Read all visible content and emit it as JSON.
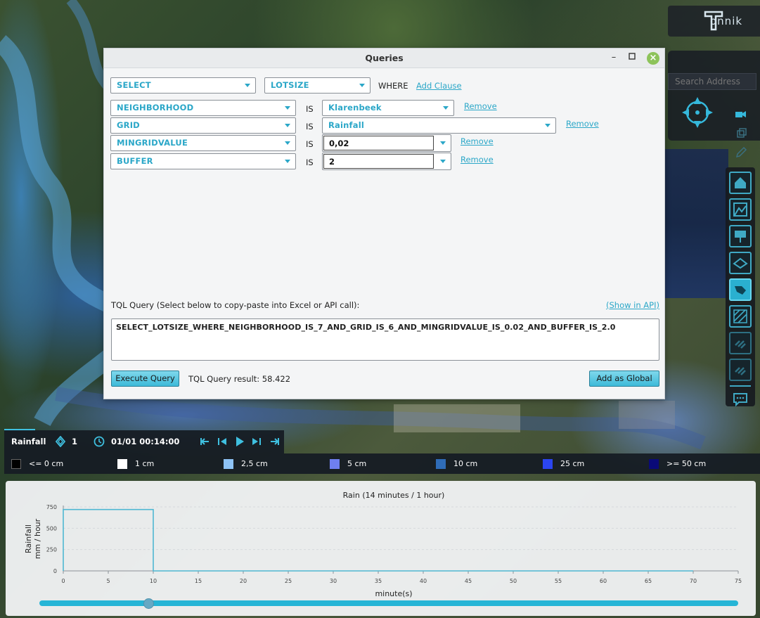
{
  "app": {
    "logo_text": "onnik"
  },
  "search": {
    "placeholder": "Search Address"
  },
  "dialog": {
    "title": "Queries",
    "header_row": {
      "select_value": "SELECT",
      "attribute_value": "LOTSIZE",
      "where_label": "WHERE",
      "add_clause_label": "Add Clause"
    },
    "clauses": [
      {
        "field": "NEIGHBORHOOD",
        "operator": "IS",
        "value": "Klarenbeek",
        "remove_label": "Remove"
      },
      {
        "field": "GRID",
        "operator": "IS",
        "value": "Rainfall",
        "remove_label": "Remove"
      },
      {
        "field": "MINGRIDVALUE",
        "operator": "IS",
        "value": "0,02",
        "remove_label": "Remove"
      },
      {
        "field": "BUFFER",
        "operator": "IS",
        "value": "2",
        "remove_label": "Remove"
      }
    ],
    "tql_label": "TQL Query (Select below to copy-paste into Excel or API call):",
    "show_in_api_label": "(Show in API)",
    "tql_query": "SELECT_LOTSIZE_WHERE_NEIGHBORHOOD_IS_7_AND_GRID_IS_6_AND_MINGRIDVALUE_IS_0.02_AND_BUFFER_IS_2.0",
    "execute_label": "Execute Query",
    "result_text": "TQL Query result: 58.422",
    "add_global_label": "Add as Global"
  },
  "timebar": {
    "layer_name": "Rainfall",
    "layer_count": "1",
    "datetime": "01/01 00:14:00"
  },
  "legend": [
    {
      "label": "<= 0 cm",
      "color": "#000000"
    },
    {
      "label": "1 cm",
      "color": "#ffffff"
    },
    {
      "label": "2,5 cm",
      "color": "#8ec3f5"
    },
    {
      "label": "5 cm",
      "color": "#6f7ff0"
    },
    {
      "label": "10 cm",
      "color": "#2f6cb8"
    },
    {
      "label": "25 cm",
      "color": "#2b45f0"
    },
    {
      "label": ">= 50 cm",
      "color": "#0a0a78"
    }
  ],
  "chart_data": {
    "type": "line",
    "title": "Rain (14 minutes / 1 hour)",
    "xlabel": "minute(s)",
    "ylabel": [
      "Rainfall",
      "mm / hour"
    ],
    "xlim": [
      0,
      75
    ],
    "ylim": [
      0,
      750
    ],
    "xticks": [
      0,
      5,
      10,
      15,
      20,
      25,
      30,
      35,
      40,
      45,
      50,
      55,
      60,
      65,
      70,
      75
    ],
    "yticks": [
      0,
      250,
      500,
      750
    ],
    "grid": true,
    "series": [
      {
        "x": [
          0,
          0,
          10,
          10,
          70
        ],
        "y": [
          0,
          720,
          720,
          0,
          0
        ]
      }
    ],
    "current_time_minutes": 14
  },
  "colors": {
    "accent": "#2ba7c8",
    "chart_line": "#4fb7d2"
  }
}
